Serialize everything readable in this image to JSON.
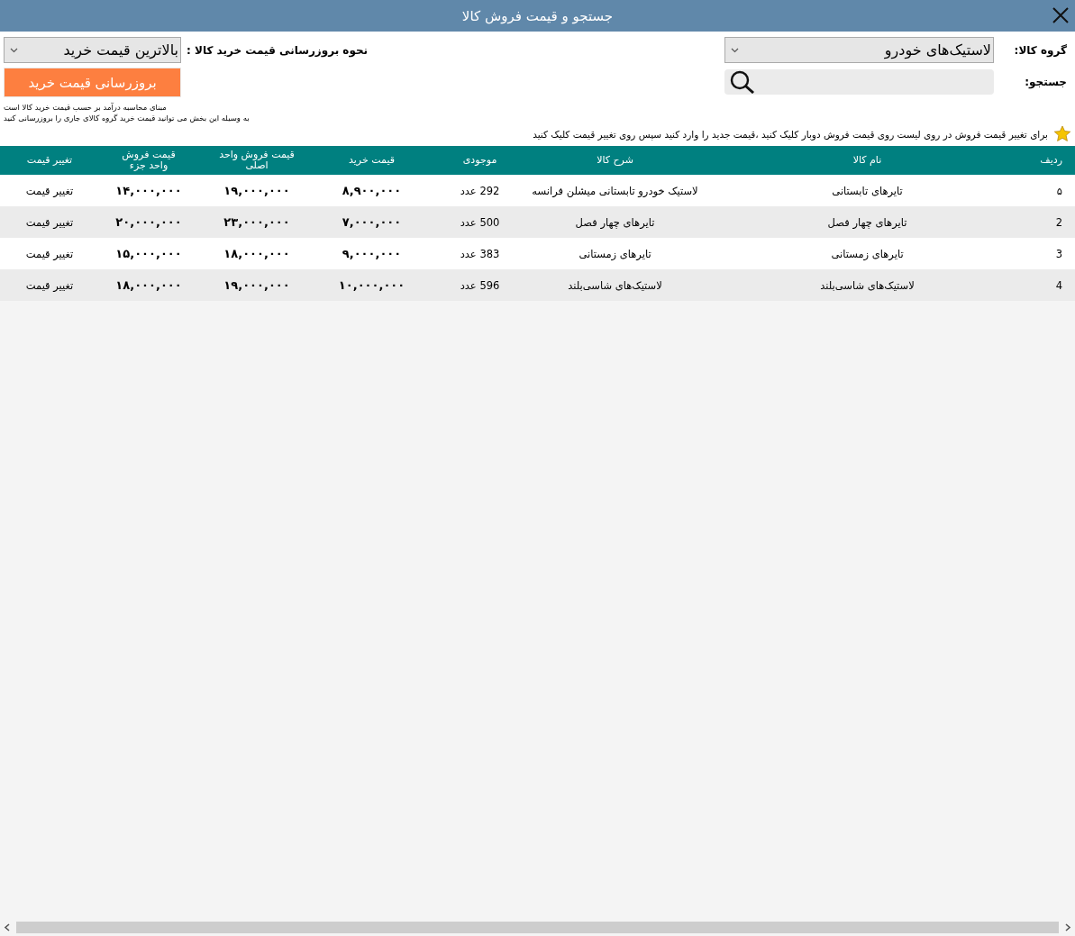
{
  "window": {
    "title": "جستجو و قیمت فروش کالا"
  },
  "filters": {
    "group_label": "گروه کالا:",
    "group_value": "لاستیک‌های خودرو",
    "search_label": "جستجو:",
    "hint": "برای تغییر قیمت فروش در روی لیست روی قیمت فروش دوبار کلیک کنید ،قیمت جدید را وارد کنید سپس روی تغییر قیمت کلیک کنید"
  },
  "update": {
    "mode_label": "نحوه بروزرسانی قیمت خرید کالا :",
    "mode_value": "بالاترین قیمت خرید",
    "button": "بروزرسانی قیمت خرید",
    "note_1": "مبنای محاسبه درآمد بر حسب قیمت خرید کالا است",
    "note_2": "به وسیله این بخش می توانید قیمت خرید گروه کالای جاری را بروزرسانی کنید"
  },
  "table": {
    "columns": [
      "ردیف",
      "نام کالا",
      "شرح کالا",
      "موجودی",
      "قیمت خرید",
      "قیمت فروش واحد اصلی",
      "قیمت فروش واحد جزء",
      "تغییر قیمت"
    ],
    "rows": [
      [
        "۵",
        "تایرهای تابستانی",
        "لاستیک خودرو تابستانی میشلن فرانسه",
        "292 عدد",
        "۸,۹۰۰,۰۰۰",
        "۱۹,۰۰۰,۰۰۰",
        "۱۴,۰۰۰,۰۰۰",
        "تغییر قیمت"
      ],
      [
        "2",
        "تایرهای چهار فصل",
        "تایرهای چهار فصل",
        "500 عدد",
        "۷,۰۰۰,۰۰۰",
        "۲۳,۰۰۰,۰۰۰",
        "۲۰,۰۰۰,۰۰۰",
        "تغییر قیمت"
      ],
      [
        "3",
        "تایرهای زمستانی",
        "تایرهای زمستانی",
        "383 عدد",
        "۹,۰۰۰,۰۰۰",
        "۱۸,۰۰۰,۰۰۰",
        "۱۵,۰۰۰,۰۰۰",
        "تغییر قیمت"
      ],
      [
        "4",
        "لاستیک‌های شاسی‌بلند",
        "لاستیک‌های شاسی‌بلند",
        "596 عدد",
        "۱۰,۰۰۰,۰۰۰",
        "۱۹,۰۰۰,۰۰۰",
        "۱۸,۰۰۰,۰۰۰",
        "تغییر قیمت"
      ]
    ]
  }
}
